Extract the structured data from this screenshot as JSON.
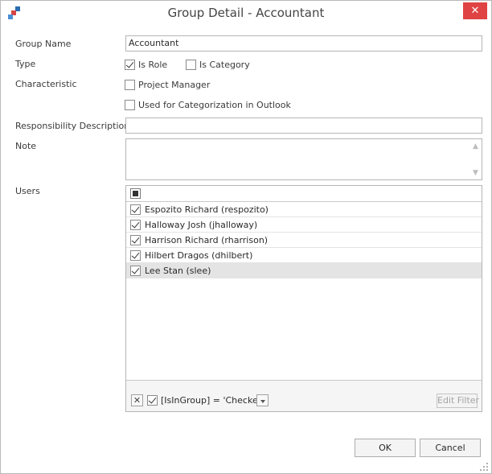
{
  "window": {
    "title": "Group Detail - Accountant",
    "close_glyph": "✕",
    "accent": "#e04343"
  },
  "form": {
    "group_name_label": "Group Name",
    "group_name_value": "Accountant",
    "type_label": "Type",
    "is_role": {
      "label": "Is Role",
      "checked": true
    },
    "is_category": {
      "label": "Is Category",
      "checked": false
    },
    "characteristic_label": "Characteristic",
    "project_manager": {
      "label": "Project Manager",
      "checked": false
    },
    "used_for_categorization": {
      "label": "Used for Categorization in Outlook",
      "checked": false
    },
    "responsibility_label": "Responsibility Description",
    "responsibility_value": "",
    "note_label": "Note",
    "note_value": "",
    "users_label": "Users"
  },
  "users": [
    {
      "label": "Espozito Richard (respozito)",
      "checked": true,
      "selected": false
    },
    {
      "label": "Halloway Josh (jhalloway)",
      "checked": true,
      "selected": false
    },
    {
      "label": "Harrison Richard (rharrison)",
      "checked": true,
      "selected": false
    },
    {
      "label": "Hilbert Dragos (dhilbert)",
      "checked": true,
      "selected": false
    },
    {
      "label": "Lee Stan (slee)",
      "checked": true,
      "selected": true
    }
  ],
  "filter": {
    "clear_glyph": "✕",
    "text": "[IsInGroup] = 'Checked'",
    "enabled": true,
    "edit_label": "Edit Filter"
  },
  "buttons": {
    "ok": "OK",
    "cancel": "Cancel"
  },
  "icons": {
    "app": "app-logo-icon",
    "close": "close-icon",
    "scroll_up": "chevron-up-icon",
    "scroll_down": "chevron-down-icon",
    "dropdown": "chevron-down-icon",
    "resize": "resize-grip-icon"
  }
}
